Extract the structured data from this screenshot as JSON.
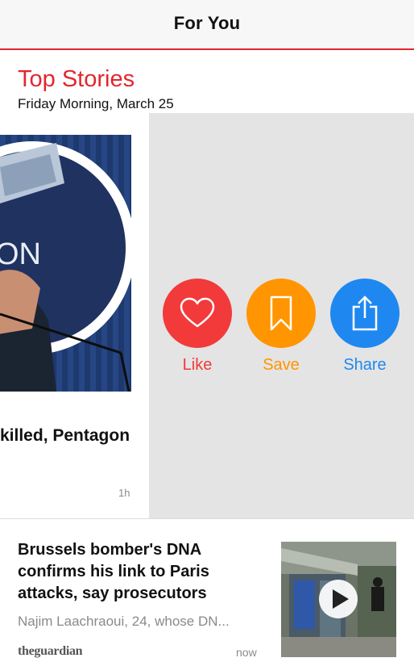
{
  "header": {
    "title": "For You"
  },
  "section": {
    "title": "Top Stories",
    "subtitle": "Friday Morning, March 25"
  },
  "featured_card": {
    "headline_partial": "killed, Pentagon",
    "time": "1h",
    "seal_text_partial": "ON"
  },
  "actions": [
    {
      "label": "Like",
      "color": "#f23a3a",
      "icon": "heart-icon"
    },
    {
      "label": "Save",
      "color": "#ff9500",
      "icon": "bookmark-icon"
    },
    {
      "label": "Share",
      "color": "#1e88f0",
      "icon": "share-icon"
    }
  ],
  "article": {
    "title": "Brussels bomber's DNA confirms his link to Paris attacks, say prosecutors",
    "summary": "Najim Laachraoui, 24, whose DN...",
    "source": "theguardian",
    "time": "now",
    "thumbnail_icon": "play-icon"
  },
  "colors": {
    "accent": "#e3262f",
    "tray": "#e4e4e4"
  }
}
